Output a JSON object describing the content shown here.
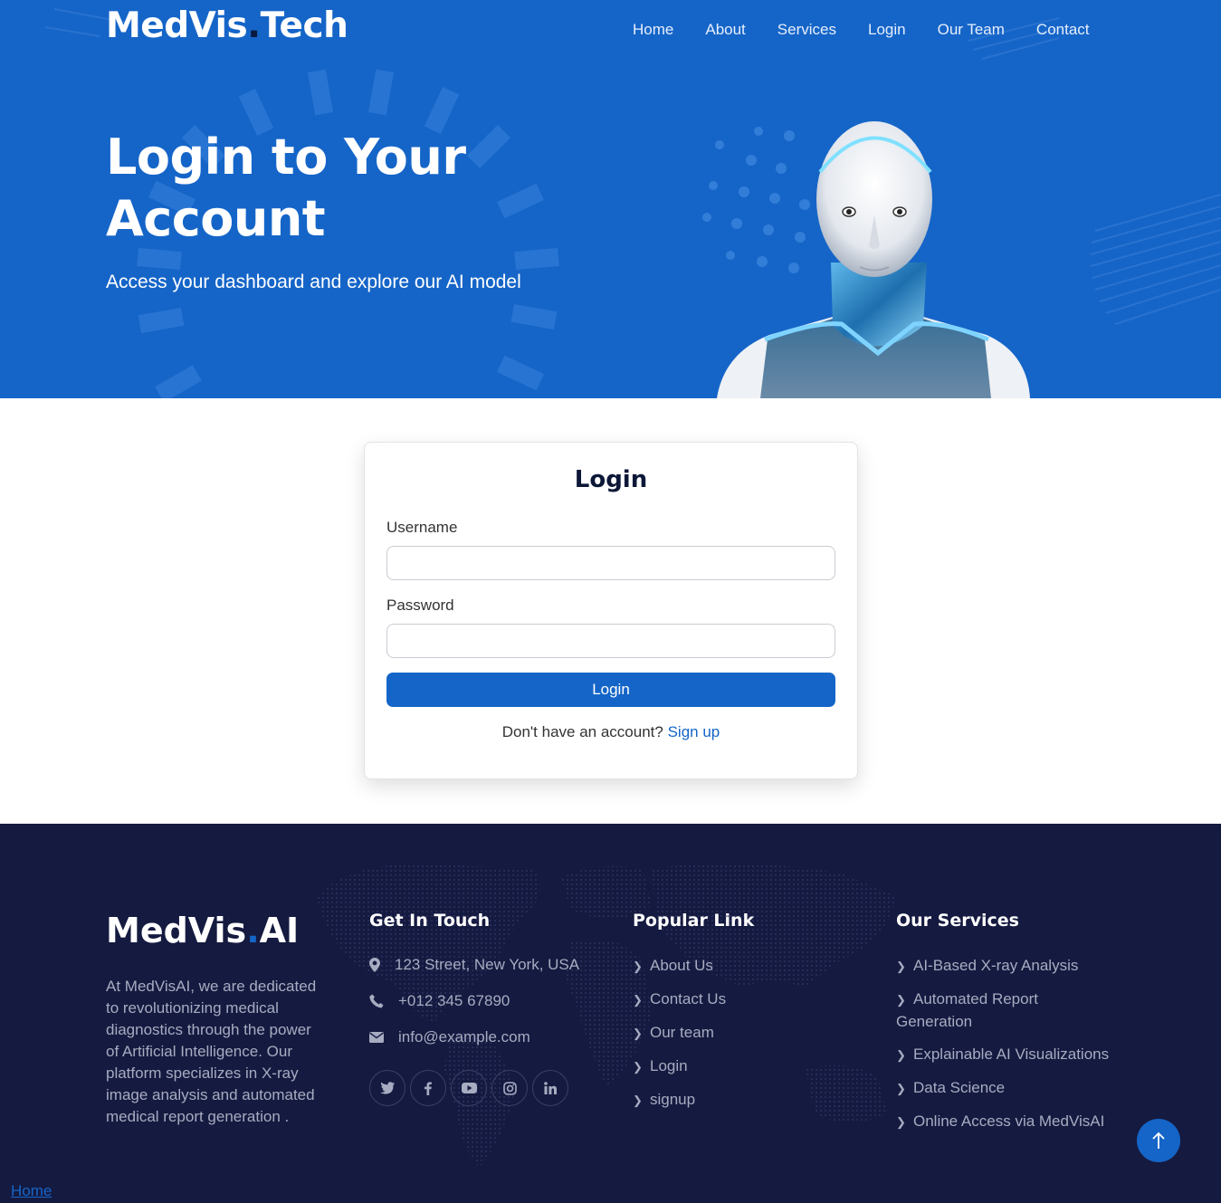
{
  "header": {
    "logo_main": "MedVis",
    "logo_dot": ".",
    "logo_suffix": "Tech",
    "nav": [
      "Home",
      "About",
      "Services",
      "Login",
      "Our Team",
      "Contact"
    ]
  },
  "hero": {
    "title": "Login to Your Account",
    "subtitle": "Access your dashboard and explore our AI model"
  },
  "login": {
    "title": "Login",
    "username_label": "Username",
    "username_value": "",
    "password_label": "Password",
    "password_value": "",
    "button_label": "Login",
    "signup_prompt": "Don't have an account?",
    "signup_link": "Sign up"
  },
  "footer": {
    "logo_main": "MedVis",
    "logo_dot": ".",
    "logo_suffix": "AI",
    "description": "At MedVisAI, we are dedicated to revolutionizing medical diagnostics through the power of Artificial Intelligence. Our platform specializes in X-ray image analysis and automated medical report generation .",
    "contact_title": "Get In Touch",
    "address": "123 Street, New York, USA",
    "phone": "+012 345 67890",
    "email": "info@example.com",
    "socials": [
      "twitter-icon",
      "facebook-icon",
      "youtube-icon",
      "instagram-icon",
      "linkedin-icon"
    ],
    "links_title": "Popular Link",
    "links": [
      "About Us",
      "Contact Us",
      "Our team",
      "Login",
      "signup"
    ],
    "services_title": "Our Services",
    "services": [
      "AI-Based X-ray Analysis",
      "Automated Report Generation",
      "Explainable AI Visualizations",
      "Data Science",
      "Online Access via MedVisAI"
    ]
  },
  "bottom_link": "Home",
  "colors": {
    "primary": "#1565c8",
    "footer_bg": "#151a40",
    "text_muted": "#a7acc1"
  }
}
